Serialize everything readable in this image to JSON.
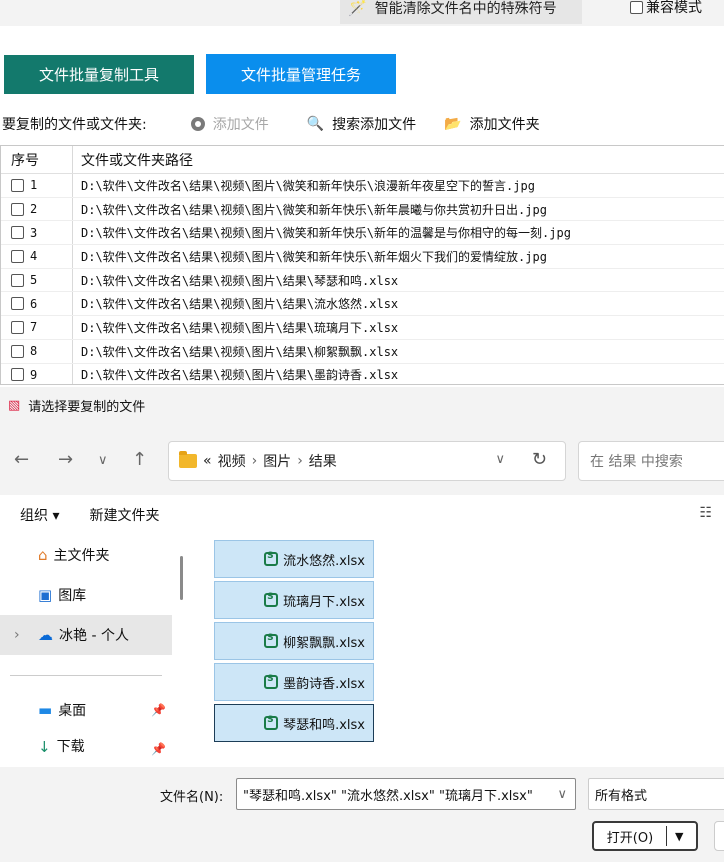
{
  "app": {
    "smart_clean_label": "智能清除文件名中的特殊符号",
    "compat_label": "兼容模式",
    "tab_copy": "文件批量复制工具",
    "tab_manage": "文件批量管理任务",
    "add_row": {
      "label": "要复制的文件或文件夹:",
      "add_file": "添加文件",
      "search_add": "搜索添加文件",
      "add_folder": "添加文件夹"
    },
    "table": {
      "headers": [
        "序号",
        "文件或文件夹路径"
      ],
      "rows": [
        {
          "num": "1",
          "path": "D:\\软件\\文件改名\\结果\\视频\\图片\\微笑和新年快乐\\浪漫新年夜星空下的誓言.jpg"
        },
        {
          "num": "2",
          "path": "D:\\软件\\文件改名\\结果\\视频\\图片\\微笑和新年快乐\\新年晨曦与你共赏初升日出.jpg"
        },
        {
          "num": "3",
          "path": "D:\\软件\\文件改名\\结果\\视频\\图片\\微笑和新年快乐\\新年的温馨是与你相守的每一刻.jpg"
        },
        {
          "num": "4",
          "path": "D:\\软件\\文件改名\\结果\\视频\\图片\\微笑和新年快乐\\新年烟火下我们的爱情绽放.jpg"
        },
        {
          "num": "5",
          "path": "D:\\软件\\文件改名\\结果\\视频\\图片\\结果\\琴瑟和鸣.xlsx"
        },
        {
          "num": "6",
          "path": "D:\\软件\\文件改名\\结果\\视频\\图片\\结果\\流水悠然.xlsx"
        },
        {
          "num": "7",
          "path": "D:\\软件\\文件改名\\结果\\视频\\图片\\结果\\琉璃月下.xlsx"
        },
        {
          "num": "8",
          "path": "D:\\软件\\文件改名\\结果\\视频\\图片\\结果\\柳絮飘飘.xlsx"
        },
        {
          "num": "9",
          "path": "D:\\软件\\文件改名\\结果\\视频\\图片\\结果\\墨韵诗香.xlsx"
        }
      ]
    }
  },
  "dialog": {
    "title": "请选择要复制的文件",
    "breadcrumb": {
      "prefix": "«",
      "items": [
        "视频",
        "图片",
        "结果"
      ]
    },
    "search_placeholder": "在 结果 中搜索",
    "toolbar": {
      "organize": "组织 ▾",
      "new_folder": "新建文件夹"
    },
    "sidebar": {
      "items": [
        "主文件夹",
        "图库",
        "冰艳 - 个人",
        "桌面",
        "下载"
      ]
    },
    "files": [
      "流水悠然.xlsx",
      "琉璃月下.xlsx",
      "柳絮飘飘.xlsx",
      "墨韵诗香.xlsx",
      "琴瑟和鸣.xlsx"
    ],
    "filename_label": "文件名(N):",
    "filename_value": "\"琴瑟和鸣.xlsx\" \"流水悠然.xlsx\" \"琉璃月下.xlsx\"",
    "filter_value": "所有格式",
    "open_label": "打开(O)"
  }
}
